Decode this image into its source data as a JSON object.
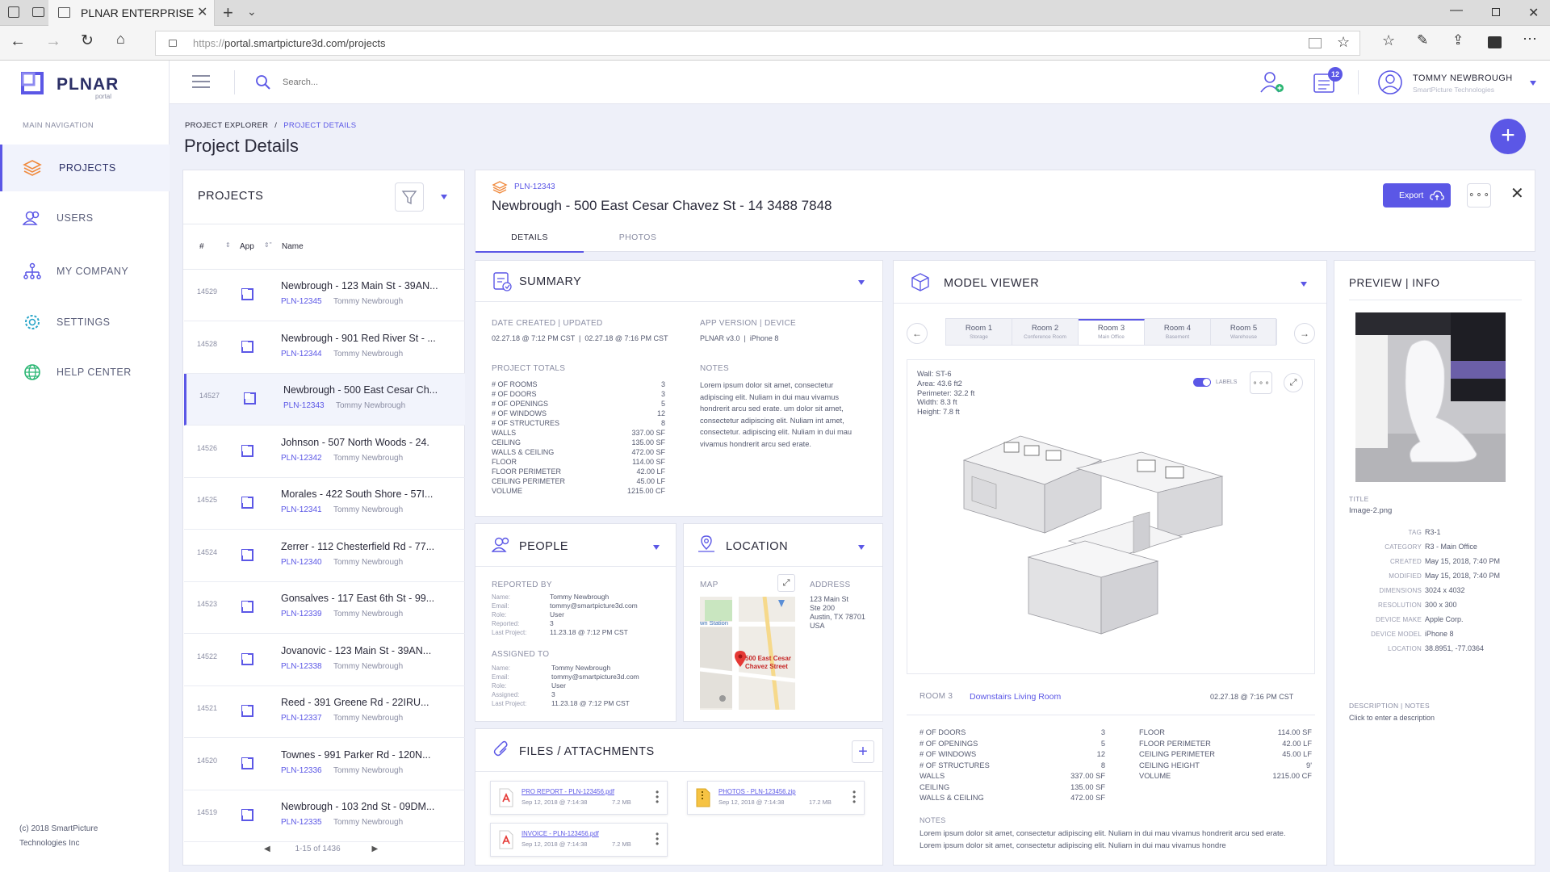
{
  "browser": {
    "tab_title": "PLNAR ENTERPRISE",
    "url_scheme": "https://",
    "url_rest": "portal.smartpicture3d.com/projects"
  },
  "brand": {
    "name": "PLNAR",
    "sub": "portal",
    "accent": "#5b57e6"
  },
  "sidebar": {
    "heading": "MAIN NAVIGATION",
    "items": [
      {
        "label": "PROJECTS",
        "icon": "layers-icon"
      },
      {
        "label": "USERS",
        "icon": "users-icon"
      },
      {
        "label": "MY COMPANY",
        "icon": "org-chart-icon"
      },
      {
        "label": "SETTINGS",
        "icon": "gear-icon"
      },
      {
        "label": "HELP CENTER",
        "icon": "globe-icon"
      }
    ],
    "footer1": "(c) 2018 SmartPicture",
    "footer2": "Technologies Inc"
  },
  "header": {
    "search_placeholder": "Search...",
    "badge": "12",
    "user_name": "TOMMY NEWBROUGH",
    "user_company": "SmartPicture Technologies"
  },
  "breadcrumb": {
    "root": "PROJECT EXPLORER",
    "sep": "/",
    "current": "PROJECT DETAILS"
  },
  "page_title": "Project Details",
  "projects": {
    "title": "PROJECTS",
    "col_num": "#",
    "col_app": "App",
    "col_name": "Name",
    "pagination": "1-15 of 1436",
    "rows": [
      {
        "num": "14529",
        "name": "Newbrough - 123 Main St - 39AN...",
        "code": "PLN-12345",
        "owner": "Tommy Newbrough"
      },
      {
        "num": "14528",
        "name": "Newbrough - 901 Red River St - ...",
        "code": "PLN-12344",
        "owner": "Tommy Newbrough"
      },
      {
        "num": "14527",
        "name": "Newbrough - 500 East Cesar Ch...",
        "code": "PLN-12343",
        "owner": "Tommy Newbrough"
      },
      {
        "num": "14526",
        "name": "Johnson - 507 North Woods - 24.",
        "code": "PLN-12342",
        "owner": "Tommy Newbrough"
      },
      {
        "num": "14525",
        "name": "Morales - 422 South Shore - 57I...",
        "code": "PLN-12341",
        "owner": "Tommy Newbrough"
      },
      {
        "num": "14524",
        "name": "Zerrer - 112 Chesterfield Rd - 77...",
        "code": "PLN-12340",
        "owner": "Tommy Newbrough"
      },
      {
        "num": "14523",
        "name": "Gonsalves - 117 East 6th St - 99...",
        "code": "PLN-12339",
        "owner": "Tommy Newbrough"
      },
      {
        "num": "14522",
        "name": "Jovanovic - 123 Main St - 39AN...",
        "code": "PLN-12338",
        "owner": "Tommy Newbrough"
      },
      {
        "num": "14521",
        "name": "Reed - 391 Greene Rd - 22IRU...",
        "code": "PLN-12337",
        "owner": "Tommy Newbrough"
      },
      {
        "num": "14520",
        "name": "Townes - 991 Parker Rd - 120N...",
        "code": "PLN-12336",
        "owner": "Tommy Newbrough"
      },
      {
        "num": "14519",
        "name": "Newbrough - 103 2nd St - 09DM...",
        "code": "PLN-12335",
        "owner": "Tommy Newbrough"
      }
    ]
  },
  "detail": {
    "code": "PLN-12343",
    "title": "Newbrough - 500 East Cesar Chavez St - 14 3488 7848",
    "export_label": "Export",
    "tabs": [
      "DETAILS",
      "PHOTOS"
    ]
  },
  "summary": {
    "title": "SUMMARY",
    "date_label": "DATE CREATED | UPDATED",
    "date_value": "02.27.18 @ 7:12 PM CST  |  02.27.18 @ 7:16 PM CST",
    "app_label": "APP VERSION | DEVICE",
    "app_value": "PLNAR v3.0  |  iPhone 8",
    "totals_label": "PROJECT TOTALS",
    "totals": [
      {
        "k": "# OF ROOMS",
        "v": "3"
      },
      {
        "k": "# OF DOORS",
        "v": "3"
      },
      {
        "k": "# OF OPENINGS",
        "v": "5"
      },
      {
        "k": "# OF WINDOWS",
        "v": "12"
      },
      {
        "k": "# OF STRUCTURES",
        "v": "8"
      },
      {
        "k": "WALLS",
        "v": "337.00 SF"
      },
      {
        "k": "CEILING",
        "v": "135.00 SF"
      },
      {
        "k": "WALLS & CEILING",
        "v": "472.00 SF"
      },
      {
        "k": "FLOOR",
        "v": "114.00 SF"
      },
      {
        "k": "FLOOR PERIMETER",
        "v": "42.00 LF"
      },
      {
        "k": "CEILING PERIMETER",
        "v": "45.00 LF"
      },
      {
        "k": "VOLUME",
        "v": "1215.00 CF"
      }
    ],
    "notes_label": "NOTES",
    "notes": "Lorem ipsum dolor sit amet, consectetur adipiscing elit. Nuliam in dui mau vivamus hondrerit arcu sed erate. um dolor sit amet, consectetur adipiscing elit. Nuliam int amet, consectetur. adipiscing elit. Nuliam in dui mau vivamus hondrerit arcu sed erate."
  },
  "people": {
    "title": "PEOPLE",
    "reported_label": "REPORTED BY",
    "reported": [
      {
        "k": "Name:",
        "v": "Tommy Newbrough"
      },
      {
        "k": "Email:",
        "v": "tommy@smartpicture3d.com"
      },
      {
        "k": "Role:",
        "v": "User"
      },
      {
        "k": "Reported:",
        "v": "3"
      },
      {
        "k": "Last Project:",
        "v": "11.23.18 @ 7:12 PM CST"
      }
    ],
    "assigned_label": "ASSIGNED TO",
    "assigned": [
      {
        "k": "Name:",
        "v": "Tommy Newbrough"
      },
      {
        "k": "Email:",
        "v": "tommy@smartpicture3d.com"
      },
      {
        "k": "Role:",
        "v": "User"
      },
      {
        "k": "Assigned:",
        "v": "3"
      },
      {
        "k": "Last Project:",
        "v": "11.23.18 @ 7:12 PM CST"
      }
    ]
  },
  "location": {
    "title": "LOCATION",
    "map_label": "MAP",
    "address_label": "ADDRESS",
    "address": [
      "123 Main St",
      "Ste 200",
      "Austin, TX 78701",
      "USA"
    ],
    "map_pin_text1": "500 East Cesar",
    "map_pin_text2": "Chavez Street",
    "map_station": "wn Station"
  },
  "files": {
    "title": "FILES / ATTACHMENTS",
    "items": [
      {
        "name": "PRO REPORT - PLN-123456.pdf",
        "date": "Sep 12, 2018 @ 7:14:38",
        "size": "7.2 MB",
        "type": "pdf"
      },
      {
        "name": "PHOTOS - PLN-123456.zip",
        "date": "Sep 12, 2018 @ 7:14:38",
        "size": "17.2 MB",
        "type": "zip"
      },
      {
        "name": "INVOICE - PLN-123456.pdf",
        "date": "Sep 12, 2018 @ 7:14:38",
        "size": "7.2 MB",
        "type": "pdf"
      }
    ]
  },
  "model": {
    "title": "MODEL VIEWER",
    "rooms": [
      {
        "name": "Room 1",
        "sub": "Storage"
      },
      {
        "name": "Room 2",
        "sub": "Conference Room"
      },
      {
        "name": "Room 3",
        "sub": "Main Office"
      },
      {
        "name": "Room 4",
        "sub": "Basement"
      },
      {
        "name": "Room 5",
        "sub": "Warehouse"
      }
    ],
    "info": [
      "Wall: ST-6",
      "Area: 43.6 ft2",
      "Perimeter: 32.2 ft",
      "Width: 8.3 ft",
      "Height: 7.8 ft"
    ],
    "labels_toggle": "LABELS",
    "room_label": "ROOM 3",
    "room_name": "Downstairs Living Room",
    "room_date": "02.27.18 @ 7:16 PM CST",
    "stats_left": [
      {
        "k": "# OF DOORS",
        "v": "3"
      },
      {
        "k": "# OF OPENINGS",
        "v": "5"
      },
      {
        "k": "# OF WINDOWS",
        "v": "12"
      },
      {
        "k": "# OF STRUCTURES",
        "v": "8"
      },
      {
        "k": "WALLS",
        "v": "337.00 SF"
      },
      {
        "k": "CEILING",
        "v": "135.00 SF"
      },
      {
        "k": "WALLS & CEILING",
        "v": "472.00 SF"
      }
    ],
    "stats_right": [
      {
        "k": "FLOOR",
        "v": "114.00 SF"
      },
      {
        "k": "FLOOR PERIMETER",
        "v": "42.00 LF"
      },
      {
        "k": "CEILING PERIMETER",
        "v": "45.00 LF"
      },
      {
        "k": "CEILING HEIGHT",
        "v": "9'"
      },
      {
        "k": "VOLUME",
        "v": "1215.00 CF"
      }
    ],
    "notes_label": "NOTES",
    "notes1": "Lorem ipsum dolor sit amet, consectetur adipiscing elit. Nuliam in dui mau vivamus hondrerit arcu sed erate.",
    "notes2": "Lorem ipsum dolor sit amet, consectetur adipiscing elit. Nuliam in dui mau vivamus hondre"
  },
  "preview": {
    "title": "PREVIEW | INFO",
    "title_label": "TITLE",
    "title_value": "Image-2.png",
    "fields": [
      {
        "k": "TAG",
        "v": "R3-1"
      },
      {
        "k": "CATEGORY",
        "v": "R3 - Main Office"
      },
      {
        "k": "CREATED",
        "v": "May 15, 2018, 7:40 PM"
      },
      {
        "k": "MODIFIED",
        "v": "May 15, 2018, 7:40 PM"
      },
      {
        "k": "DIMENSIONS",
        "v": "3024 x 4032"
      },
      {
        "k": "RESOLUTION",
        "v": "300 x 300"
      },
      {
        "k": "DEVICE MAKE",
        "v": "Apple Corp."
      },
      {
        "k": "DEVICE MODEL",
        "v": "iPhone 8"
      },
      {
        "k": "LOCATION",
        "v": "38.8951, -77.0364"
      }
    ],
    "desc_label": "DESCRIPTION | NOTES",
    "desc_value": "Click to enter a description"
  }
}
